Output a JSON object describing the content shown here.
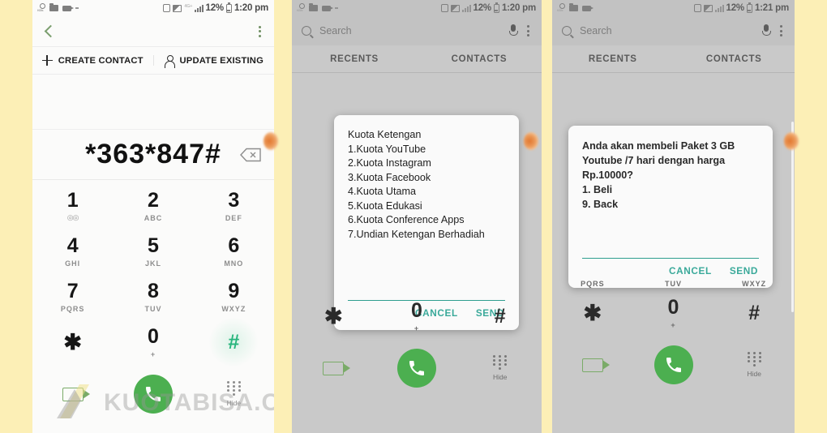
{
  "page": {
    "background_color": "#fcefb6",
    "watermark": "KUOTABISA.COM"
  },
  "panels": [
    {
      "id": "dialer-contact",
      "status_bar": {
        "time": "1:20 pm",
        "battery": "12%",
        "network": "4G+",
        "left_icons": [
          "data-speed-icon",
          "folder-icon",
          "video-recorder-icon",
          "dash-icon"
        ],
        "right_icons": [
          "alarm-icon",
          "screen-cast-icon",
          "signal-bars-icon",
          "battery-icon"
        ]
      },
      "action_bar": {
        "back": "back-icon",
        "overflow": "more-options-icon"
      },
      "contact_actions": [
        {
          "label": "CREATE CONTACT",
          "icon": "plus-icon"
        },
        {
          "label": "UPDATE EXISTING",
          "icon": "person-icon"
        }
      ],
      "number_display": {
        "value": "*363*847#",
        "backspace": "backspace-icon"
      },
      "keypad": [
        [
          {
            "digit": "1",
            "letters": "",
            "sub_icon": "voicemail-icon",
            "pressed": false
          },
          {
            "digit": "2",
            "letters": "ABC",
            "pressed": false
          },
          {
            "digit": "3",
            "letters": "DEF",
            "pressed": false
          }
        ],
        [
          {
            "digit": "4",
            "letters": "GHI",
            "pressed": false
          },
          {
            "digit": "5",
            "letters": "JKL",
            "pressed": false
          },
          {
            "digit": "6",
            "letters": "MNO",
            "pressed": false
          }
        ],
        [
          {
            "digit": "7",
            "letters": "PQRS",
            "pressed": false
          },
          {
            "digit": "8",
            "letters": "TUV",
            "pressed": false
          },
          {
            "digit": "9",
            "letters": "WXYZ",
            "pressed": false
          }
        ],
        [
          {
            "digit": "✱",
            "letters": "",
            "pressed": false
          },
          {
            "digit": "0",
            "letters": "+",
            "pressed": false
          },
          {
            "digit": "#",
            "letters": "",
            "pressed": true
          }
        ]
      ],
      "bottom_bar": {
        "video_call": "video-call-icon",
        "call": "call-icon",
        "hide_label": "Hide"
      }
    },
    {
      "id": "ussd-menu",
      "status_bar": {
        "time": "1:20 pm",
        "battery": "12%"
      },
      "search": {
        "placeholder": "Search",
        "mic": "mic-icon",
        "overflow": "more-options-icon"
      },
      "tabs": [
        {
          "label": "RECENTS"
        },
        {
          "label": "CONTACTS"
        }
      ],
      "dialog": {
        "message": "Kuota Ketengan\n1.Kuota YouTube\n2.Kuota Instagram\n3.Kuota Facebook\n4.Kuota Utama\n5.Kuota Edukasi\n6.Kuota Conference Apps\n7.Undian Ketengan Berhadiah",
        "input_value": "",
        "cancel_label": "CANCEL",
        "send_label": "SEND",
        "accent_color": "#3aa99a"
      },
      "keypad_visible_row": [
        {
          "digit": "✱",
          "letters": ""
        },
        {
          "digit": "0",
          "letters": "+"
        },
        {
          "digit": "#",
          "letters": ""
        }
      ],
      "bottom_bar": {
        "hide_label": "Hide"
      }
    },
    {
      "id": "ussd-confirm",
      "status_bar": {
        "time": "1:21 pm",
        "battery": "12%"
      },
      "search": {
        "placeholder": "Search",
        "mic": "mic-icon",
        "overflow": "more-options-icon"
      },
      "tabs": [
        {
          "label": "RECENTS"
        },
        {
          "label": "CONTACTS"
        }
      ],
      "dialog": {
        "message": "Anda akan membeli Paket 3 GB\nYoutube /7 hari dengan harga\nRp.10000?\n1. Beli\n9. Back",
        "input_value": "",
        "cancel_label": "CANCEL",
        "send_label": "SEND",
        "accent_color": "#3aa99a"
      },
      "keypad_letters_row": [
        {
          "letters": "PQRS"
        },
        {
          "letters": "TUV"
        },
        {
          "letters": "WXYZ"
        }
      ],
      "keypad_visible_row": [
        {
          "digit": "✱",
          "letters": ""
        },
        {
          "digit": "0",
          "letters": "+"
        },
        {
          "digit": "#",
          "letters": ""
        }
      ],
      "bottom_bar": {
        "hide_label": "Hide"
      }
    }
  ]
}
